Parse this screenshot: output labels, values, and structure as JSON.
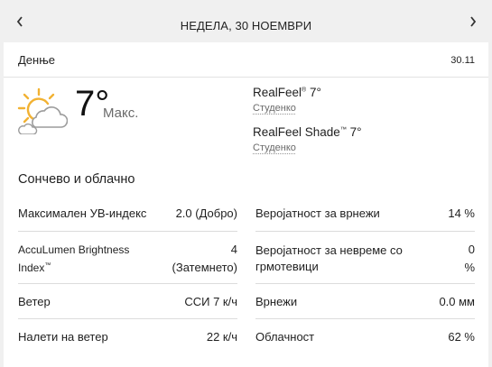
{
  "header": {
    "title": "НЕДЕЛА, 30 НОЕМВРИ",
    "prev_icon": "chevron-left-icon",
    "next_icon": "chevron-right-icon"
  },
  "card": {
    "day_label": "Денње",
    "date": "30.11",
    "temperature": "7°",
    "temperature_suffix": "Макс.",
    "icon": "partly-sunny-icon",
    "realfeel": {
      "label": "RealFeel",
      "mark": "®",
      "value": " 7°",
      "desc": "Студенко"
    },
    "realfeel_shade": {
      "label": "RealFeel Shade",
      "mark": "™",
      "value": " 7°",
      "desc": "Студенко"
    },
    "phrase": "Сончево и облачно"
  },
  "details": {
    "uv": {
      "label": "Максимален УВ-индекс",
      "value": "2.0 (Добро)"
    },
    "precip_prob": {
      "label": "Веројатност за врнежи",
      "value": "14 %"
    },
    "brightness": {
      "label": "AccuLumen Brightness Index",
      "mark": "™",
      "value_line1": "4",
      "value_line2": "(Затемнето)"
    },
    "thunder_prob": {
      "label": "Веројатност за невреме со грмотевици",
      "value_line1": "0",
      "value_line2": "%"
    },
    "wind": {
      "label": "Ветер",
      "value": "ССИ 7 к/ч"
    },
    "precip": {
      "label": "Врнежи",
      "value": "0.0 мм"
    },
    "gusts": {
      "label": "Налети на ветер",
      "value": "22 к/ч"
    },
    "cloud_cover": {
      "label": "Облачност",
      "value": "62 %"
    }
  },
  "colors": {
    "sun": "#f2b233",
    "cloud_stroke": "#9c9c9c",
    "divider": "#dcdcdc"
  }
}
